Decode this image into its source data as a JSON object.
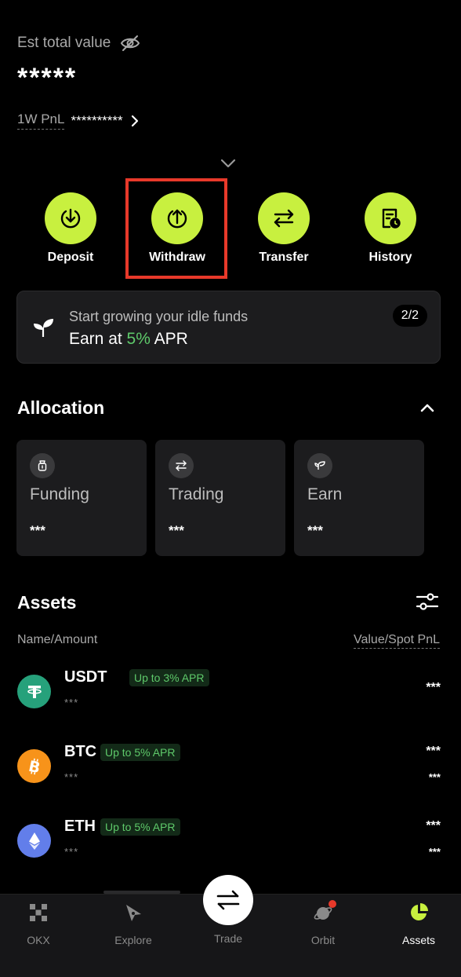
{
  "header": {
    "est_label": "Est total value",
    "total_value": "*****",
    "pnl_label": "1W PnL",
    "pnl_value": "**********"
  },
  "actions": [
    {
      "label": "Deposit",
      "icon": "deposit-icon"
    },
    {
      "label": "Withdraw",
      "icon": "withdraw-icon"
    },
    {
      "label": "Transfer",
      "icon": "transfer-icon"
    },
    {
      "label": "History",
      "icon": "history-icon"
    }
  ],
  "promo": {
    "subtitle": "Start growing your idle funds",
    "title_prefix": "Earn at ",
    "rate": "5%",
    "title_suffix": " APR",
    "page_indicator": "2/2"
  },
  "allocation": {
    "title": "Allocation",
    "cards": [
      {
        "name": "Funding",
        "value": "***",
        "icon": "funding-icon"
      },
      {
        "name": "Trading",
        "value": "***",
        "icon": "trading-icon"
      },
      {
        "name": "Earn",
        "value": "***",
        "icon": "earn-icon"
      }
    ]
  },
  "assets": {
    "title": "Assets",
    "col_left": "Name/Amount",
    "col_right": "Value/Spot PnL",
    "rows": [
      {
        "symbol": "USDT",
        "badge": "Up to 3% APR",
        "amount": "***",
        "value": "***",
        "pnl": ""
      },
      {
        "symbol": "BTC",
        "badge": "Up to 5% APR",
        "amount": "***",
        "value": "***",
        "pnl": "***"
      },
      {
        "symbol": "ETH",
        "badge": "Up to 5% APR",
        "amount": "***",
        "value": "***",
        "pnl": "***"
      }
    ]
  },
  "nav": {
    "items": [
      {
        "label": "OKX"
      },
      {
        "label": "Explore"
      },
      {
        "label": "Trade"
      },
      {
        "label": "Orbit"
      },
      {
        "label": "Assets"
      }
    ],
    "active": "Assets"
  },
  "colors": {
    "accent": "#c8f03f",
    "positive": "#5ec96a",
    "highlight": "#e8392a",
    "usdt": "#26a17b",
    "btc": "#f7931a",
    "eth": "#627eea"
  }
}
